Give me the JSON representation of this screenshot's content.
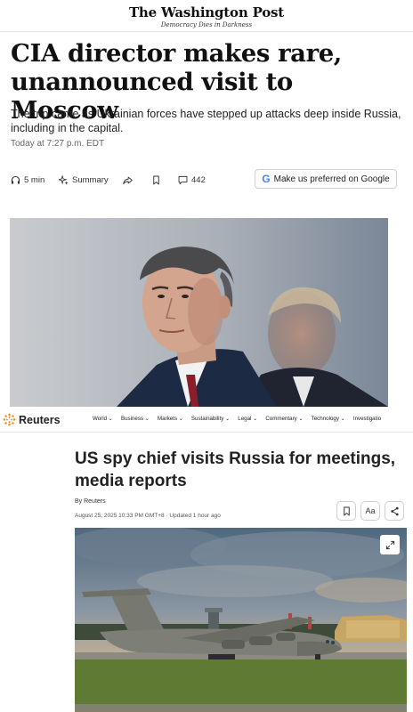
{
  "wp": {
    "logo": "The Washington Post",
    "tagline": "Democracy Dies in Darkness",
    "headline_line1": "CIA director makes rare,",
    "headline_line2": "unannounced visit to Moscow",
    "dek": "The trip came as Ukrainian forces have stepped up attacks deep inside Russia, including in the capital.",
    "timestamp": "Today at 7:27 p.m. EDT",
    "actions": {
      "read_time": "5 min",
      "summary": "Summary",
      "comments": "442",
      "preferred_label": "Make us preferred on Google",
      "preferred_icon_letter": "G"
    }
  },
  "reuters": {
    "logo": "Reuters",
    "nav": [
      "World",
      "Business",
      "Markets",
      "Sustainability",
      "Legal",
      "Commentary",
      "Technology",
      "Investigatio"
    ],
    "headline_line1": "US spy chief visits Russia for meetings,",
    "headline_line2": "media reports",
    "byline": "By Reuters",
    "date": "August 25, 2025 10:33 PM GMT+8 · Updated 1 hour ago",
    "tool_text_size": "Aa"
  },
  "colors": {
    "google_blue": "#4285F4",
    "reuters_orange": "#ff8000",
    "text_dark": "#111111"
  }
}
